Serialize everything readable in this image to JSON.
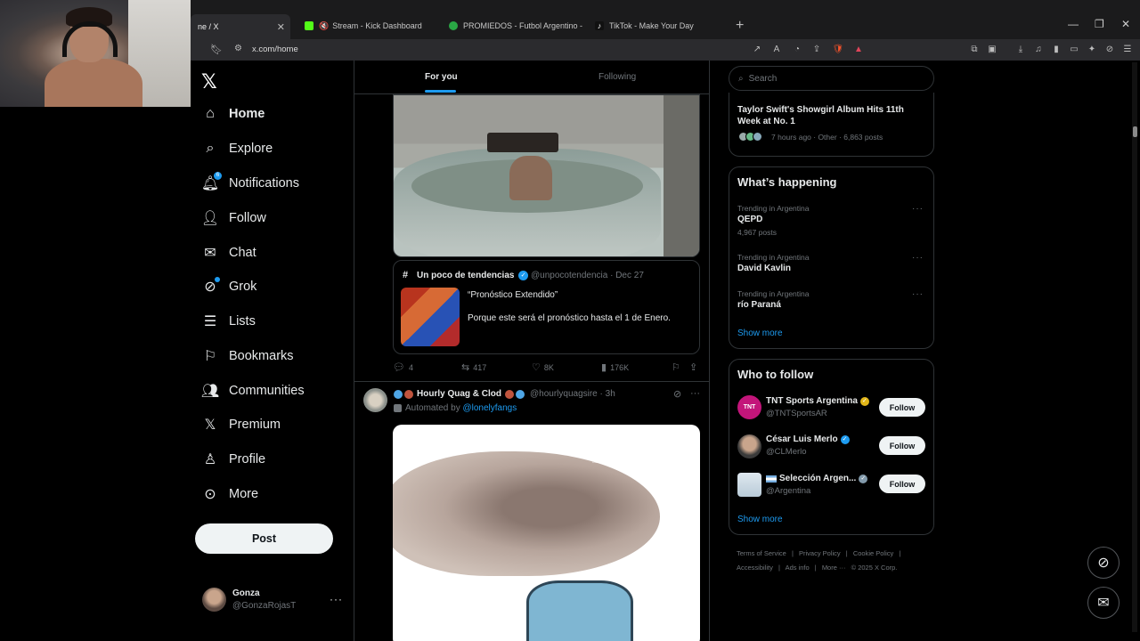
{
  "browser": {
    "tabs": [
      {
        "label": "ne / X",
        "active": true
      },
      {
        "label": "Stream - Kick Dashboard",
        "active": false
      },
      {
        "label": "PROMIEDOS - Futbol Argentino - Fix",
        "active": false
      },
      {
        "label": "TikTok - Make Your Day",
        "active": false
      }
    ],
    "url": "x.com/home",
    "colors": {
      "kick": "#53fc18",
      "promiedos": "#2aa745",
      "tiktok": "#ffffff"
    }
  },
  "nav": {
    "items": [
      {
        "label": "Home",
        "icon": "home-icon"
      },
      {
        "label": "Explore",
        "icon": "search-icon"
      },
      {
        "label": "Notifications",
        "icon": "bell-icon",
        "badge": "6"
      },
      {
        "label": "Follow",
        "icon": "person-add-icon"
      },
      {
        "label": "Chat",
        "icon": "mail-icon"
      },
      {
        "label": "Grok",
        "icon": "grok-icon"
      },
      {
        "label": "Lists",
        "icon": "list-icon"
      },
      {
        "label": "Bookmarks",
        "icon": "bookmark-icon"
      },
      {
        "label": "Communities",
        "icon": "people-icon"
      },
      {
        "label": "Premium",
        "icon": "x-logo-icon"
      },
      {
        "label": "Profile",
        "icon": "person-icon"
      },
      {
        "label": "More",
        "icon": "more-circle-icon"
      }
    ],
    "post_label": "Post",
    "user": {
      "name": "Gonza",
      "handle": "@GonzaRojasT"
    }
  },
  "feed": {
    "tabs": {
      "for_you": "For you",
      "following": "Following"
    },
    "tweet1": {
      "quote": {
        "name": "Un poco de tendencias",
        "handle_date": "@unpocotendencia · Dec 27",
        "title": "“Pronóstico Extendido”",
        "text": "Porque este será el pronóstico hasta el 1 de Enero."
      },
      "actions": {
        "replies": "4",
        "reposts": "417",
        "likes": "8K",
        "views": "176K"
      }
    },
    "tweet2": {
      "name": "Hourly Quag & Clod",
      "handle_time": "@hourlyquagsire · 3h",
      "automated_prefix": "Automated by",
      "automated_by": "@lonelyfangs"
    }
  },
  "right": {
    "search_placeholder": "Search",
    "news": {
      "title": "Taylor Swift's Showgirl Album Hits 11th Week at No. 1",
      "meta": "7 hours ago · Other · 6,863 posts"
    },
    "happening": {
      "heading": "What’s happening",
      "trends": [
        {
          "context": "Trending in Argentina",
          "name": "QEPD",
          "count": "4,967 posts"
        },
        {
          "context": "Trending in Argentina",
          "name": "David Kavlin",
          "count": ""
        },
        {
          "context": "Trending in Argentina",
          "name": "río Paraná",
          "count": ""
        }
      ],
      "show_more": "Show more"
    },
    "who_to_follow": {
      "heading": "Who to follow",
      "accounts": [
        {
          "name": "TNT Sports Argentina",
          "handle": "@TNTSportsAR",
          "badge_color": "#e2b719"
        },
        {
          "name": "César Luis Merlo",
          "handle": "@CLMerlo",
          "badge_color": "#1d9bf0"
        },
        {
          "name": "Selección Argen...",
          "handle": "@Argentina",
          "badge_color": "#829aab"
        }
      ],
      "follow_label": "Follow",
      "show_more": "Show more"
    },
    "footer": [
      "Terms of Service",
      "|",
      "Privacy Policy",
      "|",
      "Cookie Policy",
      "|",
      "Accessibility",
      "|",
      "Ads info",
      "|",
      "More ···",
      "© 2025 X Corp."
    ]
  }
}
